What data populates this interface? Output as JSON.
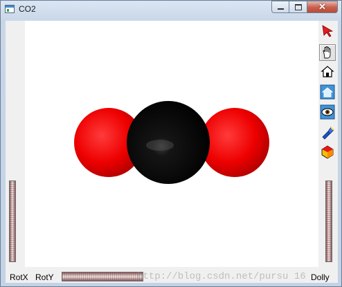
{
  "window": {
    "title": "CO2",
    "controls": {
      "minimize": "minimize",
      "maximize": "maximize",
      "close": "close"
    }
  },
  "toolbar": {
    "tools": [
      {
        "icon": "select-arrow-icon",
        "active": false
      },
      {
        "icon": "hand-rotate-icon",
        "active": true
      },
      {
        "icon": "home-view-icon",
        "active": false
      },
      {
        "icon": "set-home-icon",
        "active": false
      },
      {
        "icon": "view-all-icon",
        "active": false
      },
      {
        "icon": "headlight-icon",
        "active": false
      },
      {
        "icon": "draw-style-icon",
        "active": false
      }
    ]
  },
  "labels": {
    "rotx": "RotX",
    "roty": "RotY",
    "dolly": "Dolly"
  },
  "watermark": "http://blog.csdn.net/pursu 16",
  "molecule": {
    "atoms": [
      "O",
      "C",
      "O"
    ],
    "colors": {
      "oxygen": "#ff0000",
      "carbon": "#000000"
    }
  }
}
